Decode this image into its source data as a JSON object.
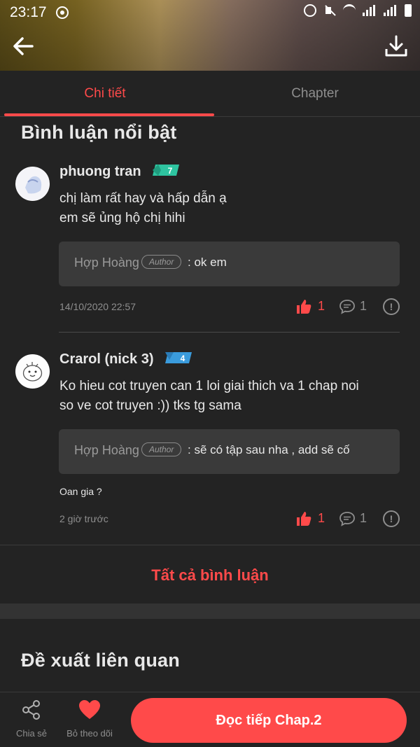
{
  "status_bar": {
    "time": "23:17"
  },
  "tabs": [
    {
      "label": "Chi tiết",
      "active": true
    },
    {
      "label": "Chapter",
      "active": false
    }
  ],
  "featured_comments": {
    "title": "Bình luận nổi bật",
    "comments": [
      {
        "user": "phuong tran",
        "level": "7",
        "text_lines": [
          "chị làm rất hay và hấp dẫn ạ",
          "em sẽ ủng hộ chị hihi"
        ],
        "reply": {
          "author": "Hợp Hoàng",
          "tag": "Author",
          "text": ": ok em"
        },
        "extra": "",
        "time": "14/10/2020 22:57",
        "likes": "1",
        "replies": "1"
      },
      {
        "user": "Crarol (nick 3)",
        "level": "4",
        "text_lines": [
          "Ko hieu cot truyen can 1 loi giai thich va 1 chap noi",
          "so ve cot truyen :)) tks tg sama"
        ],
        "reply": {
          "author": "Hợp Hoàng",
          "tag": "Author",
          "text": ": sẽ có tập sau nha , add sẽ cố"
        },
        "extra": "Oan gia ?",
        "time": "2 giờ trước",
        "likes": "1",
        "replies": "1"
      }
    ],
    "all_label": "Tất cả bình luận"
  },
  "related": {
    "title": "Đề xuất liên quan"
  },
  "bottom_bar": {
    "share_label": "Chia sẻ",
    "unfollow_label": "Bỏ theo dõi",
    "read_button": "Đọc tiếp Chap.2"
  },
  "colors": {
    "accent": "#ff4a4a",
    "background": "#232323",
    "reply_box": "#3a3a3a",
    "badge_level_7": "#2ec4a0",
    "badge_level_4": "#3a9bdc"
  },
  "icons": [
    "back-arrow-icon",
    "download-icon",
    "like-icon",
    "comment-icon",
    "report-icon",
    "share-icon",
    "heart-icon"
  ]
}
